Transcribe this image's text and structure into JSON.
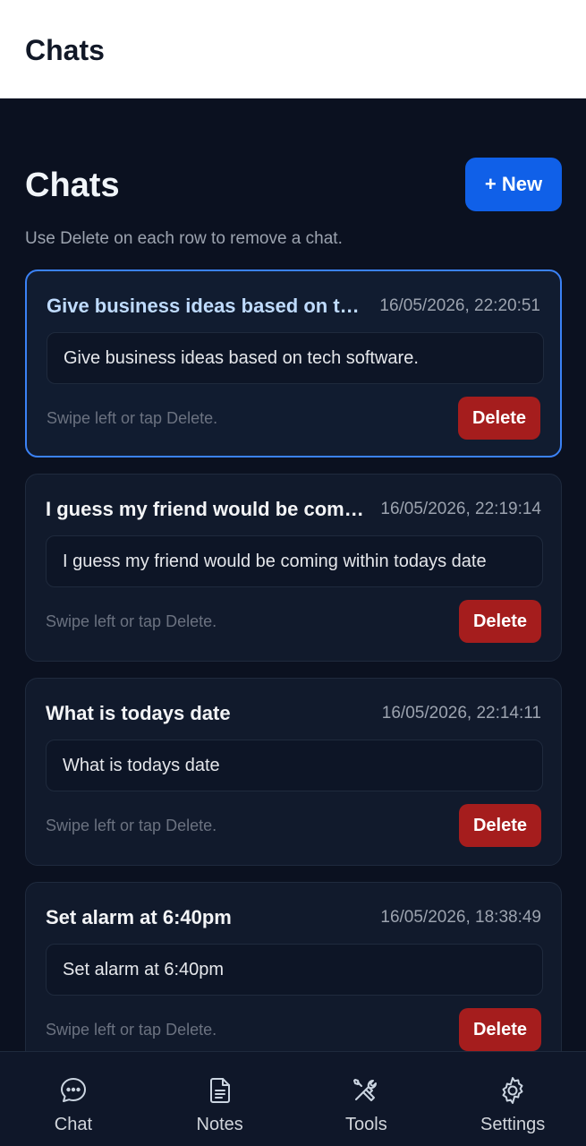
{
  "appbar": {
    "title": "Chats"
  },
  "page": {
    "title": "Chats",
    "new_button": "+ New",
    "subtitle": "Use Delete on each row to remove a chat."
  },
  "chats": [
    {
      "title": "Give business ideas based on tech software.",
      "time": "16/05/2026, 22:20:51",
      "preview": "Give business ideas based on tech software.",
      "hint": "Swipe left or tap Delete.",
      "delete_label": "Delete",
      "selected": true
    },
    {
      "title": "I guess my friend would be coming within todays date",
      "time": "16/05/2026, 22:19:14",
      "preview": "I guess my friend would be coming within todays date",
      "hint": "Swipe left or tap Delete.",
      "delete_label": "Delete",
      "selected": false
    },
    {
      "title": "What is todays date",
      "time": "16/05/2026, 22:14:11",
      "preview": "What is todays date",
      "hint": "Swipe left or tap Delete.",
      "delete_label": "Delete",
      "selected": false
    },
    {
      "title": "Set alarm at 6:40pm",
      "time": "16/05/2026, 18:38:49",
      "preview": "Set alarm at 6:40pm",
      "hint": "Swipe left or tap Delete.",
      "delete_label": "Delete",
      "selected": false
    }
  ],
  "bottom_nav": [
    {
      "label": "Chat",
      "icon": "chat-bubble-icon"
    },
    {
      "label": "Notes",
      "icon": "document-icon"
    },
    {
      "label": "Tools",
      "icon": "tools-icon"
    },
    {
      "label": "Settings",
      "icon": "gear-icon"
    }
  ],
  "colors": {
    "background": "#0b1120",
    "card": "#111a2c",
    "accent": "#1060e8",
    "selected_border": "#3b82f6",
    "delete": "#a51d1d"
  }
}
